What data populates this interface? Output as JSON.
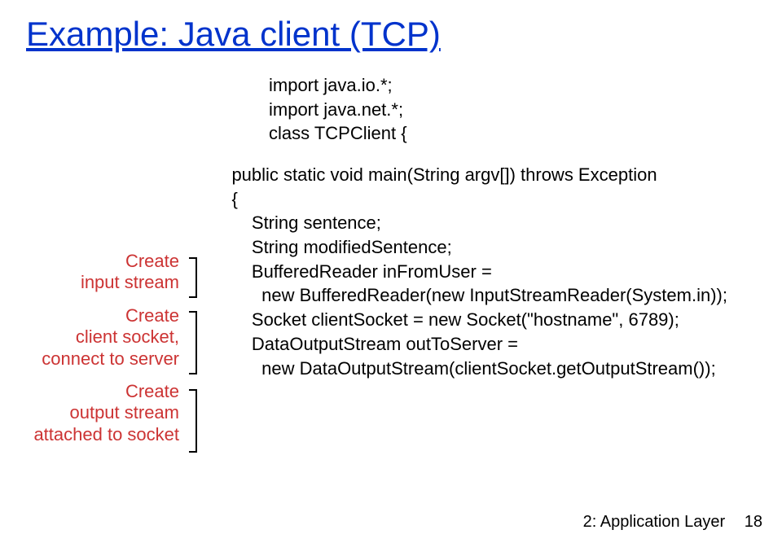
{
  "title": "Example: Java client (TCP)",
  "code_header": {
    "l1": "import java.io.*;",
    "l2": "import java.net.*;",
    "l3": "class TCPClient {"
  },
  "annotations": {
    "a1_l1": "Create",
    "a1_l2": "input stream",
    "a2_l1": "Create",
    "a2_l2": "client socket,",
    "a2_l3": "connect to server",
    "a3_l1": "Create",
    "a3_l2": "output stream",
    "a3_l3": "attached to socket"
  },
  "code_body": {
    "b1": "    public static void main(String argv[]) throws Exception",
    "b2": "    {",
    "b3": "        String sentence;",
    "b4": "        String modifiedSentence;",
    "b5": "",
    "b6": "        BufferedReader inFromUser =",
    "b7": "          new BufferedReader(new InputStreamReader(System.in));",
    "b8": "",
    "b9": "        Socket clientSocket = new Socket(\"hostname\", 6789);",
    "b10": "",
    "b11": "        DataOutputStream outToServer =",
    "b12": "          new DataOutputStream(clientSocket.getOutputStream());"
  },
  "footer": {
    "label": "2: Application Layer",
    "page": "18"
  }
}
